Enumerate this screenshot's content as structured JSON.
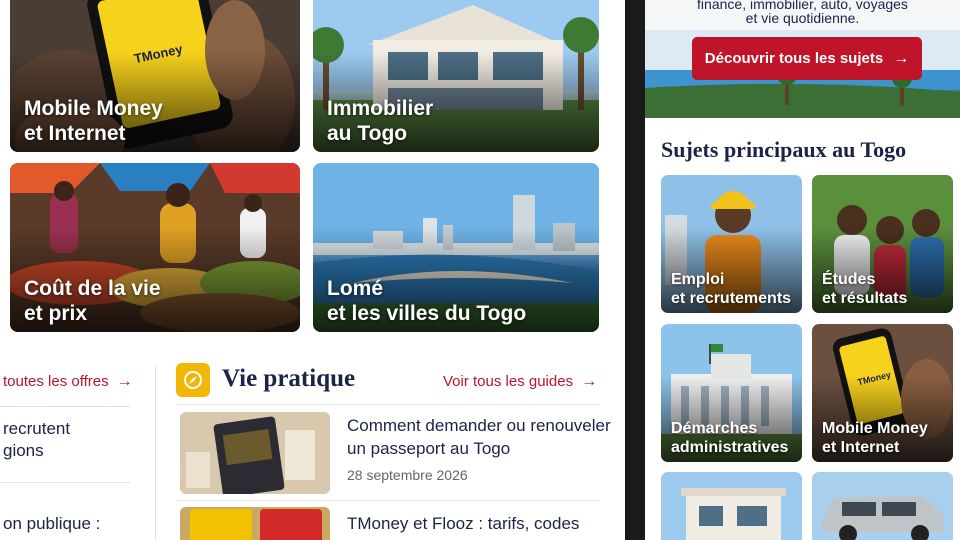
{
  "desktop": {
    "tiles": [
      {
        "line1": "Mobile Money",
        "line2": "et Internet"
      },
      {
        "line1": "Immobilier",
        "line2": "au Togo"
      },
      {
        "line1": "Coût de la vie",
        "line2": "et prix"
      },
      {
        "line1": "Lomé",
        "line2": "et les villes du Togo"
      }
    ],
    "money_brand": "TMoney",
    "left_column": {
      "see_all_offers": "toutes les offres",
      "item1_line1": "recrutent",
      "item1_line2": "gions",
      "item2": "on publique :"
    },
    "vie_pratique": {
      "title": "Vie pratique",
      "see_all": "Voir tous les guides",
      "articles": [
        {
          "title_line1": "Comment demander ou renouveler",
          "title_line2": "un passeport au Togo",
          "date": "28 septembre 2026"
        },
        {
          "title_line1": "TMoney et Flooz : tarifs, codes",
          "title_line2": ""
        }
      ]
    }
  },
  "phone": {
    "hero_line1": "finance, immobilier, auto, voyages",
    "hero_line2": "et vie quotidienne.",
    "cta_label": "Découvrir tous les sujets",
    "section_title": "Sujets principaux au Togo",
    "tiles": [
      {
        "line1": "Emploi",
        "line2": "et recrutements"
      },
      {
        "line1": "Études",
        "line2": "et résultats"
      },
      {
        "line1": "Démarches",
        "line2": "administratives"
      },
      {
        "line1": "Mobile Money",
        "line2": "et Internet"
      }
    ],
    "money_brand": "TMoney"
  },
  "colors": {
    "accent_red": "#c0142b",
    "navy": "#1b2347",
    "yellow": "#f2b705"
  }
}
